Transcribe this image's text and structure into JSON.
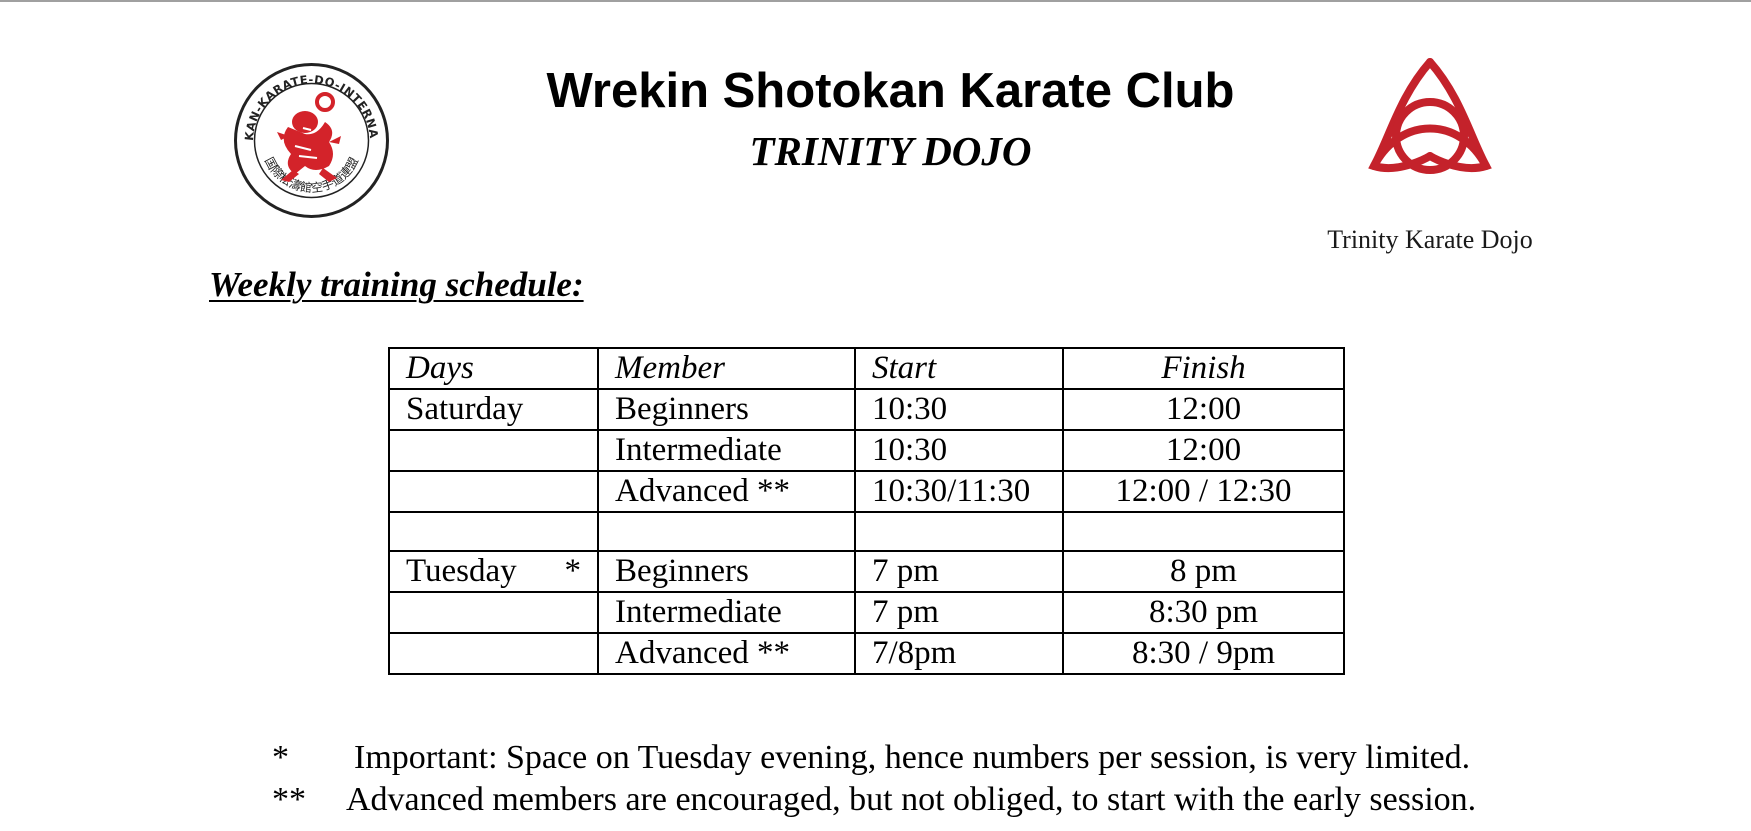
{
  "header": {
    "title": "Wrekin Shotokan Karate Club",
    "subtitle": "TRINITY DOJO",
    "right_logo_caption": "Trinity Karate Dojo",
    "left_logo_ring_text": "SHOTOKAN-KARATE-DO-INTERNATIONAL",
    "left_logo_kanji": "国際松濤館空手道連盟"
  },
  "schedule_heading": "Weekly training schedule:",
  "table": {
    "headers": {
      "days": "Days",
      "member": "Member",
      "start": "Start",
      "finish": "Finish"
    },
    "rows": [
      {
        "day": "Saturday",
        "day_mark": "",
        "member": "Beginners",
        "start": "10:30",
        "finish": "12:00"
      },
      {
        "day": "",
        "day_mark": "",
        "member": "Intermediate",
        "start": "10:30",
        "finish": "12:00"
      },
      {
        "day": "",
        "day_mark": "",
        "member": "Advanced **",
        "start": "10:30/11:30",
        "finish": "12:00 / 12:30"
      },
      {
        "day": "",
        "day_mark": "",
        "member": "",
        "start": "",
        "finish": ""
      },
      {
        "day": "Tuesday",
        "day_mark": "*",
        "member": "Beginners",
        "start": "7 pm",
        "finish": "8 pm"
      },
      {
        "day": "",
        "day_mark": "",
        "member": "Intermediate",
        "start": "7 pm",
        "finish": "8:30 pm"
      },
      {
        "day": "",
        "day_mark": "",
        "member": "Advanced **",
        "start": "7/8pm",
        "finish": "8:30 / 9pm"
      }
    ]
  },
  "notes": [
    {
      "mark": "*",
      "text": "Important: Space on Tuesday evening, hence numbers per session, is very limited."
    },
    {
      "mark": "**",
      "text": "Advanced members are encouraged, but not obliged, to start with the early session."
    }
  ],
  "colors": {
    "logo_red": "#d3232a",
    "trinity_red": "#c4222b",
    "text": "#000000"
  },
  "icons": {
    "left_logo": "shotokan-tiger-emblem-icon",
    "right_logo": "triquetra-knot-icon"
  }
}
